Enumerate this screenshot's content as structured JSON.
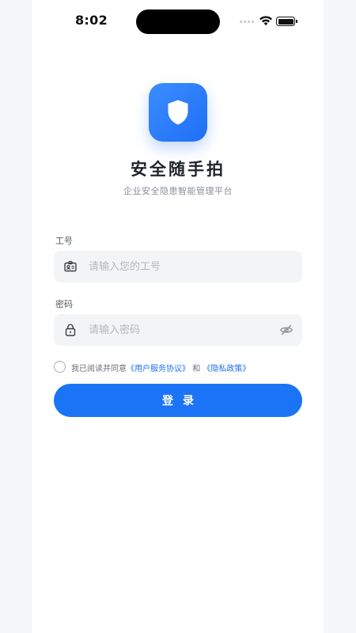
{
  "status_bar": {
    "time": "8:02",
    "icons": [
      "signal-dots-icon",
      "wifi-icon",
      "battery-icon"
    ]
  },
  "logo": {
    "icon": "shield-icon",
    "colors": {
      "gradient_start": "#3b8dff",
      "gradient_end": "#1f6ff5"
    }
  },
  "app": {
    "title": "安全随手拍",
    "subtitle": "企业安全隐患智能管理平台"
  },
  "form": {
    "employee_id": {
      "label": "工号",
      "placeholder": "请输入您的工号",
      "value": "",
      "icon": "id-card-icon"
    },
    "password": {
      "label": "密码",
      "placeholder": "请输入密码",
      "value": "",
      "icon": "lock-icon",
      "toggle_icon": "eye-off-icon"
    },
    "agreement": {
      "checked": false,
      "prefix": "我已阅读并同意",
      "user_agreement": "《用户服务协议》",
      "conjunction": "和",
      "privacy_policy": "《隐私政策》"
    },
    "submit_label": "登录"
  },
  "colors": {
    "primary": "#1b74f6",
    "field_bg": "#f3f4f6",
    "link": "#1f6ff5"
  }
}
